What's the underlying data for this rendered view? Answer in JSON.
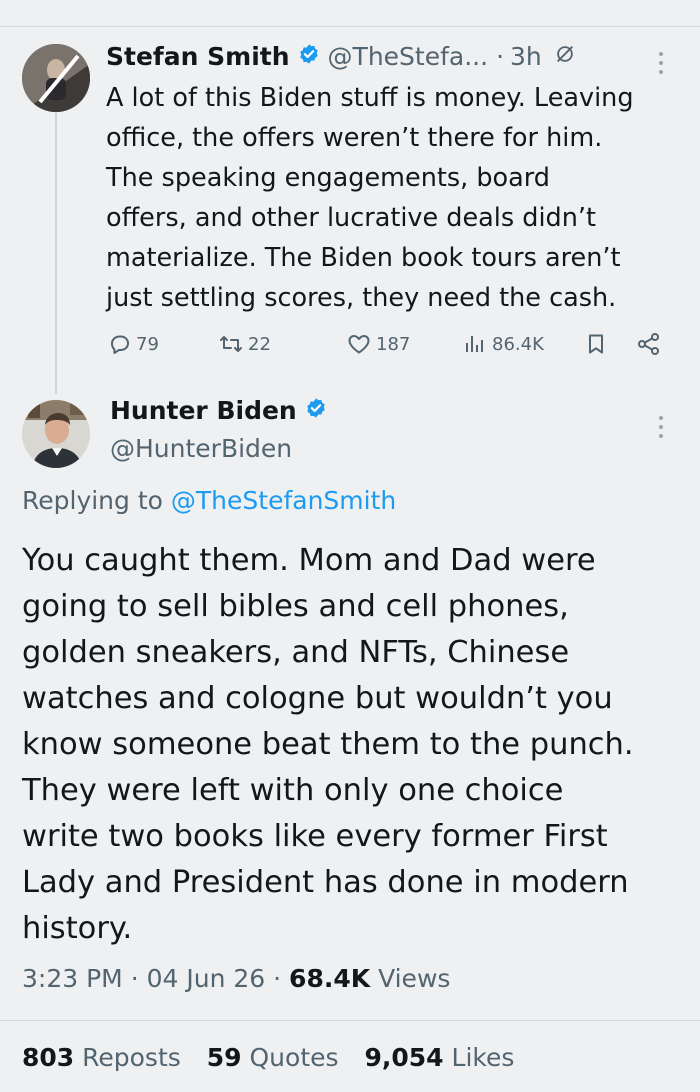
{
  "tweet1": {
    "name": "Stefan Smith",
    "handle": "@TheStefa...",
    "separator": "·",
    "time": "3h",
    "body_lines": [
      "A lot of this Biden stuff is money. Leaving",
      "office, the offers weren’t there for him.",
      "The speaking engagements, board",
      "offers, and other lucrative deals didn’t",
      "materialize. The Biden book tours aren’t",
      "just settling scores, they need the cash."
    ],
    "replies": "79",
    "reposts": "22",
    "likes": "187",
    "views": "86.4K"
  },
  "tweet2": {
    "name": "Hunter Biden",
    "handle": "@HunterBiden",
    "replying_prefix": "Replying to",
    "replying_to": "@TheStefanSmith",
    "body_lines": [
      "You caught them. Mom and Dad were",
      "going to sell bibles and cell phones,",
      "golden sneakers, and NFTs, Chinese",
      "watches and cologne but wouldn’t you",
      "know someone beat them to the punch.",
      "They were left with only one choice",
      "write two books like every former First",
      "Lady and President has done in modern",
      "history."
    ],
    "time": "3:23 PM",
    "date": "04 Jun 26",
    "separator": "·",
    "views_count": "68.4K",
    "views_label": "Views",
    "reposts_count": "803",
    "reposts_label": "Reposts",
    "quotes_count": "59",
    "quotes_label": "Quotes",
    "likes_count": "9,054",
    "likes_label": "Likes"
  },
  "icons": {
    "verified": "verified-badge-icon",
    "grok": "grok-icon",
    "more": "more-options-icon",
    "reply": "reply-icon",
    "repost": "repost-icon",
    "like": "like-icon",
    "views": "views-icon",
    "bookmark": "bookmark-icon",
    "share": "share-icon"
  },
  "colors": {
    "background": "#eef0f1",
    "text": "#14171a",
    "secondary": "#536471",
    "accent": "#1d9bf0",
    "thread_line": "#cfd4d8"
  }
}
